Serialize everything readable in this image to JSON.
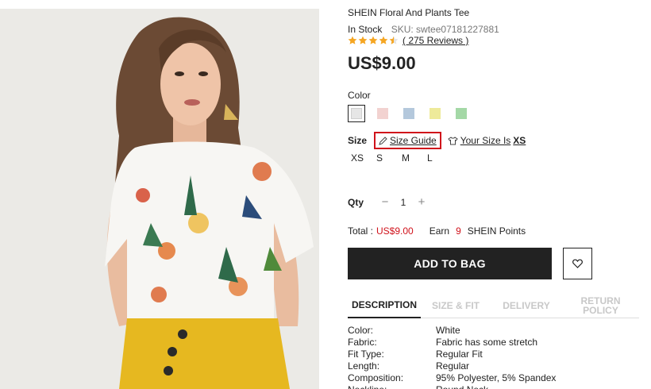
{
  "product": {
    "title": "SHEIN Floral And Plants Tee",
    "stock": "In Stock",
    "sku": "SKU: swtee07181227881",
    "rating": 4.5,
    "reviews": "( 275 Reviews )",
    "price": "US$9.00"
  },
  "color": {
    "label": "Color",
    "swatches": [
      {
        "name": "white",
        "hex": "#e6e6e6"
      },
      {
        "name": "pink",
        "hex": "#f2d2d0"
      },
      {
        "name": "blue",
        "hex": "#b4c8dc"
      },
      {
        "name": "yellow",
        "hex": "#eeea9a"
      },
      {
        "name": "green",
        "hex": "#a4d8a6"
      }
    ]
  },
  "size": {
    "label": "Size",
    "guide": "Size Guide",
    "your_size_prefix": "Your Size Is",
    "your_size_value": "XS",
    "options": [
      "XS",
      "S",
      "M",
      "L"
    ]
  },
  "qty": {
    "label": "Qty",
    "minus": "−",
    "value": "1",
    "plus": "+"
  },
  "total": {
    "label": "Total :",
    "value": "US$9.00",
    "earn": "Earn",
    "points": "9",
    "points_label": "SHEIN Points"
  },
  "actions": {
    "add_to_bag": "ADD TO BAG",
    "wishlist_icon": "heart-icon"
  },
  "tabs": [
    {
      "label": "DESCRIPTION",
      "active": true
    },
    {
      "label": "SIZE & FIT",
      "active": false
    },
    {
      "label": "DELIVERY",
      "active": false
    },
    {
      "label": "RETURN POLICY",
      "active": false
    }
  ],
  "description": [
    {
      "key": "Color:",
      "value": "White"
    },
    {
      "key": "Fabric:",
      "value": "Fabric has some stretch"
    },
    {
      "key": "Fit Type:",
      "value": "Regular Fit"
    },
    {
      "key": "Length:",
      "value": "Regular"
    },
    {
      "key": "Composition:",
      "value": "95% Polyester, 5% Spandex"
    },
    {
      "key": "Neckline:",
      "value": "Round Neck"
    }
  ],
  "colors": {
    "accent_red": "#d0121b",
    "star": "#f5a623",
    "button": "#222222"
  }
}
